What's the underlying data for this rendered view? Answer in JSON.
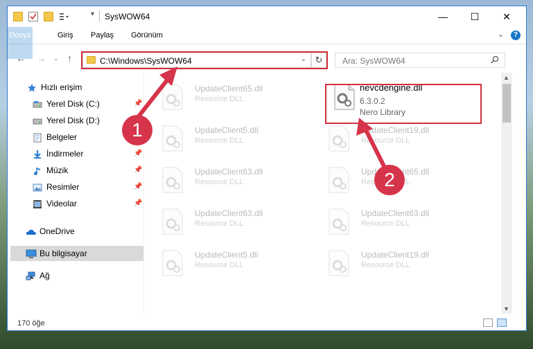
{
  "window": {
    "title": "SysWOW64"
  },
  "ribbon": {
    "tabs": [
      "Dosya",
      "Giriş",
      "Paylaş",
      "Görünüm"
    ],
    "help": "?"
  },
  "nav": {
    "address": "C:\\Windows\\SysWOW64",
    "search_placeholder": "Ara: SysWOW64"
  },
  "sidebar": {
    "items": [
      {
        "label": "Hızlı erişim",
        "icon": "star-icon"
      },
      {
        "label": "Yerel Disk (C:)",
        "icon": "drive-icon",
        "pinned": true
      },
      {
        "label": "Yerel Disk (D:)",
        "icon": "drive-icon"
      },
      {
        "label": "Belgeler",
        "icon": "documents-icon",
        "pinned": true
      },
      {
        "label": "İndirmeler",
        "icon": "download-icon",
        "pinned": true
      },
      {
        "label": "Müzik",
        "icon": "music-icon",
        "pinned": true
      },
      {
        "label": "Resimler",
        "icon": "pictures-icon",
        "pinned": true
      },
      {
        "label": "Videolar",
        "icon": "video-icon",
        "pinned": true
      },
      {
        "label": "OneDrive",
        "icon": "cloud-icon"
      },
      {
        "label": "Bu bilgisayar",
        "icon": "computer-icon",
        "selected": true
      },
      {
        "label": "Ağ",
        "icon": "network-icon"
      }
    ]
  },
  "files": {
    "highlighted": {
      "name": "nevcdengine.dll",
      "version": "6.3.0.2",
      "description": "Nero Library"
    },
    "faded": [
      {
        "name": "UpdateClient65.dll",
        "description": "Resource DLL"
      },
      {
        "name": "UpdateClient5.dll",
        "description": "Resource DLL"
      },
      {
        "name": "UpdateClient19.dll",
        "description": "Resource DLL"
      },
      {
        "name": "UpdateClient63.dll",
        "description": "Resource DLL"
      },
      {
        "name": "UpdateClient65.dll",
        "description": "Resource DLL"
      },
      {
        "name": "UpdateClient63.dll",
        "description": "Resource DLL"
      },
      {
        "name": "UpdateClient63.dll",
        "description": "Resource DLL"
      },
      {
        "name": "UpdateClient5.dll",
        "description": "Resource DLL"
      },
      {
        "name": "UpdateClient19.dll",
        "description": "Resource DLL"
      }
    ]
  },
  "status": {
    "count": "170 öğe"
  },
  "annotations": {
    "badge1": "1",
    "badge2": "2",
    "color": "#d6344a"
  }
}
